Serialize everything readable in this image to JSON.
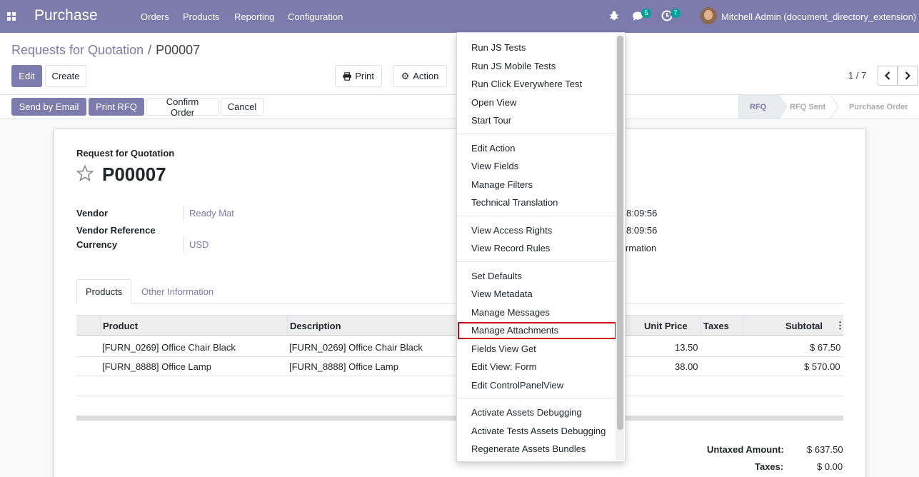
{
  "navbar": {
    "app_name": "Purchase",
    "menu": [
      "Orders",
      "Products",
      "Reporting",
      "Configuration"
    ],
    "messages_count": "5",
    "activities_count": "7",
    "user": "Mitchell Admin (document_directory_extension)"
  },
  "breadcrumb": {
    "parent": "Requests for Quotation",
    "current": "P00007"
  },
  "buttons": {
    "edit": "Edit",
    "create": "Create",
    "print": "Print",
    "action": "Action"
  },
  "pager": {
    "value": "1 / 7"
  },
  "header_buttons": {
    "send_email": "Send by Email",
    "print_rfq": "Print RFQ",
    "confirm": "Confirm Order",
    "cancel": "Cancel"
  },
  "status_steps": [
    "RFQ",
    "RFQ Sent",
    "Purchase Order"
  ],
  "status_active": "RFQ",
  "form": {
    "doc_type": "Request for Quotation",
    "name": "P00007",
    "vendor_label": "Vendor",
    "vendor": "Ready Mat",
    "vendor_ref_label": "Vendor Reference",
    "currency_label": "Currency",
    "currency": "USD",
    "right_value_1": "8:09:56",
    "right_value_2": "8:09:56",
    "right_value_3": "irmation"
  },
  "tabs": [
    "Products",
    "Other Information"
  ],
  "table": {
    "headers": {
      "product": "Product",
      "description": "Description",
      "unit_price": "Unit Price",
      "taxes": "Taxes",
      "subtotal": "Subtotal"
    },
    "rows": [
      {
        "product": "[FURN_0269] Office Chair Black",
        "description": "[FURN_0269] Office Chair Black",
        "unit_price": "13.50",
        "subtotal": "$ 67.50"
      },
      {
        "product": "[FURN_8888] Office Lamp",
        "description": "[FURN_8888] Office Lamp",
        "unit_price": "38.00",
        "subtotal": "$ 570.00"
      }
    ]
  },
  "totals": {
    "untaxed_label": "Untaxed Amount:",
    "untaxed": "$ 637.50",
    "taxes_label": "Taxes:",
    "taxes": "$ 0.00"
  },
  "debug_menu": {
    "group1": [
      "Run JS Tests",
      "Run JS Mobile Tests",
      "Run Click Everywhere Test",
      "Open View",
      "Start Tour"
    ],
    "group2": [
      "Edit Action",
      "View Fields",
      "Manage Filters",
      "Technical Translation"
    ],
    "group3": [
      "View Access Rights",
      "View Record Rules"
    ],
    "group4": [
      "Set Defaults",
      "View Metadata",
      "Manage Messages",
      "Manage Attachments",
      "Fields View Get",
      "Edit View: Form",
      "Edit ControlPanelView"
    ],
    "group5": [
      "Activate Assets Debugging",
      "Activate Tests Assets Debugging",
      "Regenerate Assets Bundles"
    ]
  },
  "colors": {
    "brand": "#7c7bad",
    "badge": "#00a09d",
    "highlight_border": "#d0021b"
  }
}
